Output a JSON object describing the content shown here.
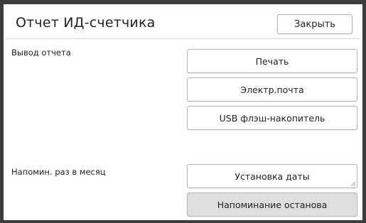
{
  "title": "Отчет ИД-счетчика",
  "close_label": "Закрыть",
  "report_output": {
    "label": "Вывод отчета",
    "buttons": [
      "Печать",
      "Электр.почта",
      "USB флэш-накопитель"
    ]
  },
  "monthly_reminder": {
    "label": "Напомин. раз в месяц",
    "date_button": "Установка даты",
    "stop_button": "Напоминание останова"
  }
}
